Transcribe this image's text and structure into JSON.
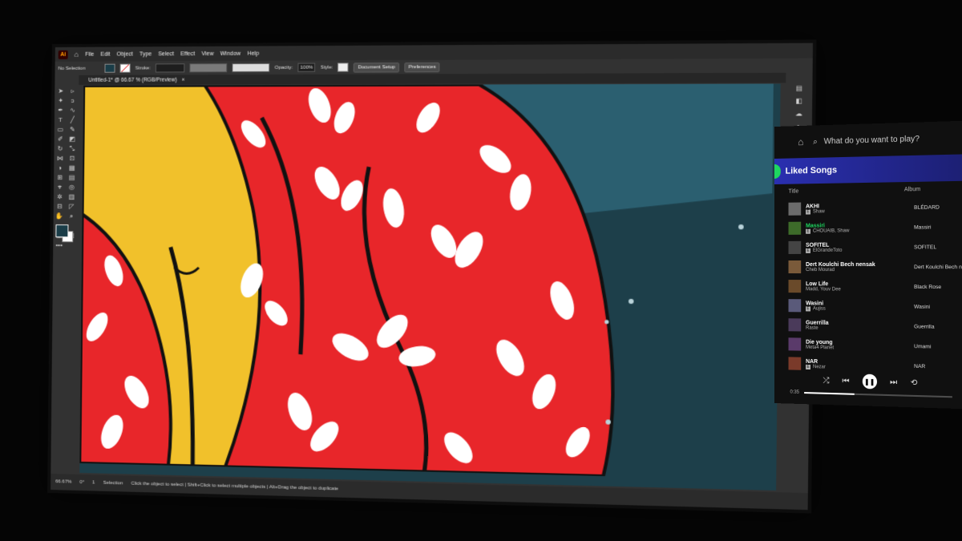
{
  "illustrator": {
    "logo": "Ai",
    "menu": [
      "File",
      "Edit",
      "Object",
      "Type",
      "Select",
      "Effect",
      "View",
      "Window",
      "Help"
    ],
    "control": {
      "selection_label": "No Selection",
      "stroke_label": "Stroke:",
      "opacity_label": "Opacity:",
      "opacity_value": "100%",
      "style_label": "Style:",
      "document_setup": "Document Setup",
      "preferences": "Preferences"
    },
    "tab": {
      "title": "Untitled-1* @ 66.67 % (RGB/Preview)",
      "close": "×"
    },
    "status": {
      "zoom": "66.67%",
      "rotation": "0°",
      "artboard": "1",
      "hint": "Click the object to select  |  Shift+Click to select multiple objects  |  Alt+Drag the object to duplicate",
      "tool": "Selection"
    },
    "colors": {
      "fill": "#1a3d48",
      "canvas_bg": "#1d3f4a",
      "red": "#e8262a",
      "yellow": "#f1c12b"
    }
  },
  "spotify": {
    "search_placeholder": "What do you want to play?",
    "playlist_title": "Liked Songs",
    "col_title": "Title",
    "col_album": "Album",
    "tracks": [
      {
        "song": "AKHI",
        "artist": "Shaw",
        "album": "BLÉDARD",
        "explicit": true,
        "active": false
      },
      {
        "song": "Massiri",
        "artist": "CHOUAIB, Shaw",
        "album": "Massiri",
        "explicit": true,
        "active": true
      },
      {
        "song": "SOFITEL",
        "artist": "ElGrandeToto",
        "album": "SOFITEL",
        "explicit": true,
        "active": false
      },
      {
        "song": "Dert Koulchi Bech nensak",
        "artist": "Cheb Mourad",
        "album": "Dert Koulchi Bech n",
        "explicit": false,
        "active": false
      },
      {
        "song": "Low Life",
        "artist": "Madd, Youv Dee",
        "album": "Black Rose",
        "explicit": false,
        "active": false
      },
      {
        "song": "Wasini",
        "artist": "Aujiss",
        "album": "Wasini",
        "explicit": true,
        "active": false
      },
      {
        "song": "Guerrilla",
        "artist": "Raste",
        "album": "Guerrilla",
        "explicit": false,
        "active": false
      },
      {
        "song": "Die young",
        "artist": "Meta4 Planet",
        "album": "Umami",
        "explicit": false,
        "active": false
      },
      {
        "song": "NAR",
        "artist": "Nezar",
        "album": "NAR",
        "explicit": true,
        "active": false
      }
    ],
    "player": {
      "elapsed": "0:35",
      "progress": 0.35
    },
    "colors": {
      "accent": "#1ed760",
      "header": "#2a2fb0"
    }
  }
}
